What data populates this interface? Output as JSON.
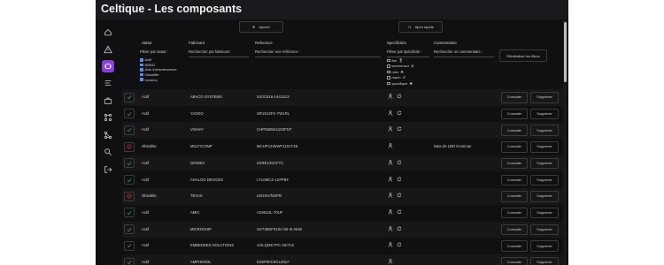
{
  "app": {
    "title": "Celtique - Les composants"
  },
  "sidebar": {
    "items": [
      {
        "icon": "home-icon"
      },
      {
        "icon": "warning-icon"
      },
      {
        "icon": "chip-icon",
        "active": true
      },
      {
        "icon": "list-icon"
      },
      {
        "icon": "briefcase-icon"
      },
      {
        "icon": "nodes-icon"
      },
      {
        "icon": "nodes-alt-icon"
      },
      {
        "icon": "search-settings-icon"
      },
      {
        "icon": "logout-icon"
      }
    ]
  },
  "toolbar": {
    "add_icon": "⊕",
    "add_label": "Ajouter",
    "quickadd_icon": "+1",
    "quickadd_label": "Ajout rapide"
  },
  "columns": {
    "statut": "Statut",
    "fabricant": "Fabricant",
    "reference": "Reference",
    "specificites": "Specificités",
    "commentaire": "Commentaire"
  },
  "filters": {
    "statut_label": "Filtrer par statut :",
    "fabricant_placeholder": "Rechercher par fabricant :",
    "reference_placeholder": "Rechercher une référence :",
    "spec_label": "Filtrer par spécificité :",
    "commentaire_placeholder": "Rechercher un commentaire :",
    "reset_label": "Réinitialiser les filtres",
    "statuses": [
      "Actif",
      "NRND",
      "Avis d'obsolescence",
      "Obsolète",
      "Inconnu"
    ],
    "specs": [
      "itar",
      "weeeensor",
      "rohs",
      "reach",
      "specifique"
    ]
  },
  "rows": [
    {
      "status": "ok",
      "statut": "Actif",
      "fabricant": "ABACO SYSTEMS",
      "reference": "S10C516-1441213",
      "specs": [
        "person",
        "refresh"
      ],
      "commentaire": ""
    },
    {
      "status": "ok",
      "statut": "Actif",
      "fabricant": "YAGEO",
      "reference": "SR1513FX-7W1RL",
      "specs": [
        "person",
        "refresh"
      ],
      "commentaire": ""
    },
    {
      "status": "ok",
      "statut": "Actif",
      "fabricant": "VISHAY",
      "reference": "CHP0505K1102FNT",
      "specs": [
        "person",
        "refresh"
      ],
      "commentaire": ""
    },
    {
      "status": "obsolete",
      "statut": "Obsolète",
      "fabricant": "MULTICOMP",
      "reference": "MCHP1225WF1101T4E",
      "specs": [
        "person"
      ],
      "commentaire": "Date de LBO inconnue"
    },
    {
      "status": "ok",
      "statut": "Actif",
      "fabricant": "DIODES",
      "reference": "ZXRE125CFTC",
      "specs": [
        "person",
        "refresh"
      ],
      "commentaire": ""
    },
    {
      "status": "ok",
      "statut": "Actif",
      "fabricant": "ANALOG DEVICES",
      "reference": "LT10MCZ-12#PBF",
      "specs": [
        "person",
        "refresh"
      ],
      "commentaire": ""
    },
    {
      "status": "obsolete",
      "statut": "Obsolète",
      "fabricant": "TEXAS",
      "reference": "LM1SH/NOPB",
      "specs": [
        "person",
        "refresh"
      ],
      "commentaire": ""
    },
    {
      "status": "ok",
      "statut": "Actif",
      "fabricant": "AMIC",
      "reference": "A29010L-70UF",
      "specs": [
        "person",
        "refresh"
      ],
      "commentaire": ""
    },
    {
      "status": "ok",
      "statut": "Actif",
      "fabricant": "MICROCHIP",
      "reference": "SST39SF010A-55-4I-NHE",
      "specs": [
        "person",
        "refresh"
      ],
      "commentaire": ""
    },
    {
      "status": "ok",
      "statut": "Actif",
      "fabricant": "EMBEDDED SOLUTIONS",
      "reference": "AOLQMK7PC-33I7LE",
      "specs": [
        "person",
        "refresh"
      ],
      "commentaire": ""
    },
    {
      "status": "ok",
      "statut": "Actif",
      "fabricant": "AMPHENOL",
      "reference": "D25P90C6GL00LF",
      "specs": [
        "person"
      ],
      "commentaire": ""
    }
  ],
  "row_actions": {
    "view_label": "Consulter",
    "delete_label": "Supprimer"
  },
  "colors": {
    "accent": "#8b3fd9",
    "ok": "#3f9d4e",
    "obsolete": "#c0392b",
    "background": "#101012"
  }
}
